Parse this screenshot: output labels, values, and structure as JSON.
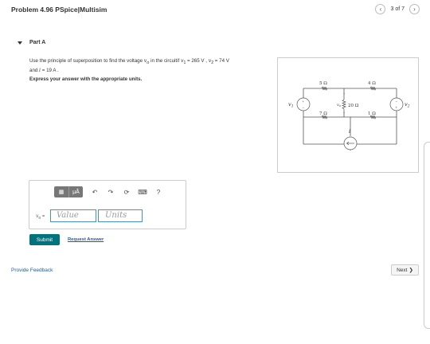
{
  "header": {
    "title": "Problem 4.96 PSpice|Multisim",
    "pager_text": "3 of 7",
    "prev_glyph": "‹",
    "next_glyph": "›"
  },
  "part": {
    "label": "Part A"
  },
  "problem": {
    "line1_pre": "Use the principle of superposition to find the voltage ",
    "vo": "v",
    "vo_sub": "o",
    "line1_mid": " in the circuitif ",
    "v1": "v",
    "v1_sub": "1",
    "v1_val": " = 265 V , ",
    "v2": "v",
    "v2_sub": "2",
    "v2_val": " = 74 V",
    "line2_pre": "and ",
    "i_sym": "i",
    "i_val": " = 19 A .",
    "instruction": "Express your answer with the appropriate units."
  },
  "circuit": {
    "r1": "5 Ω",
    "r2": "4 Ω",
    "r3": "20 Ω",
    "r4": "7 Ω",
    "r5": "1 Ω",
    "vo_label": "v",
    "vo_sub": "o",
    "src1": "v",
    "src1_sub": "1",
    "src2": "v",
    "src2_sub": "2",
    "isrc": "i",
    "plus": "+",
    "minus": "−"
  },
  "answer": {
    "label": "v",
    "label_sub": "o",
    "label_eq": " =",
    "value_placeholder": "Value",
    "units_placeholder": "Units",
    "toolbar": {
      "templates_glyph": "▦",
      "units_glyph": "μÅ",
      "undo_glyph": "↶",
      "redo_glyph": "↷",
      "reset_glyph": "⟳",
      "keyboard_glyph": "⌨",
      "help_glyph": "?"
    }
  },
  "actions": {
    "submit_label": "Submit",
    "request_answer_label": "Request Answer",
    "feedback_label": "Provide Feedback",
    "next_label": "Next",
    "next_glyph": "❯"
  }
}
